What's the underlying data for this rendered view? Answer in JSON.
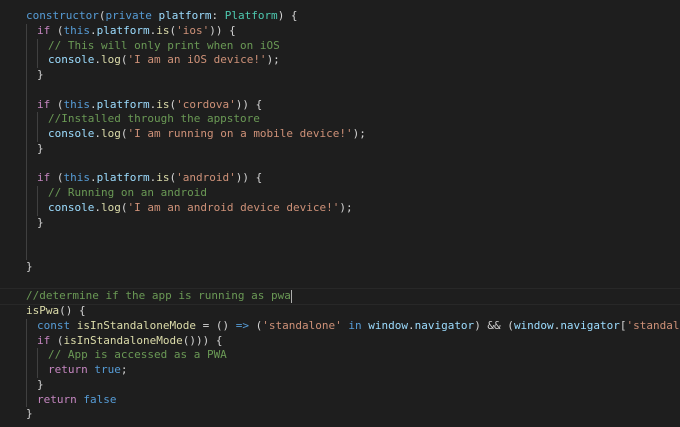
{
  "editor": {
    "theme": {
      "background": "#1e1e1e",
      "keyword": "#569cd6",
      "control": "#c586c0",
      "function": "#dcdcaa",
      "variable": "#9cdcfe",
      "type": "#4ec9b0",
      "string": "#ce9178",
      "comment": "#6a9955",
      "text": "#d4d4d4"
    },
    "tokens": {
      "t_constructor": "constructor",
      "t_open_paren": "(",
      "t_private": "private",
      "t_space": " ",
      "t_platform": "platform",
      "t_colon": ": ",
      "t_Platform": "Platform",
      "t_close_brace_open": ") {",
      "t_if": "if",
      "t_paren_open": " (",
      "t_this": "this",
      "t_dot": ".",
      "t_is": "is",
      "t_ios": "'ios'",
      "t_close_if": ")) {",
      "t_cmt_ios": "// This will only print when on iOS",
      "t_console": "console",
      "t_log": "log",
      "t_str_ios": "'I am an iOS device!'",
      "t_end_stmt": ");",
      "t_close_brace": "}",
      "t_cordova": "'cordova'",
      "t_cmt_store": "//Installed through the appstore",
      "t_str_mobile": "'I am running on a mobile device!'",
      "t_android": "'android'",
      "t_cmt_android": "// Running on an android",
      "t_str_android": "'I am an android device device!'",
      "t_cmt_pwa": "//determine if the app is running as pwa",
      "t_isPwa": "isPwa",
      "t_empty_brace": "() {",
      "t_const": "const",
      "t_standalone_var": "isInStandaloneMode",
      "t_eq_arrow_a": " = () ",
      "t_arrow": "=>",
      "t_paren_sp": " (",
      "t_str_standalone": "'standalone'",
      "t_in": "in",
      "t_window": "window",
      "t_navigator": "navigator",
      "t_and": ") && (",
      "t_bracket_open": "[",
      "t_bracket_close": "]",
      "t_end_paren_semi": ");",
      "t_call_brace": "())) {",
      "t_open_call": "(",
      "t_cmt_accessed": "// App is accessed as a PWA",
      "t_return": "return",
      "t_true": "true",
      "t_semi": ";",
      "t_false": "false"
    }
  }
}
